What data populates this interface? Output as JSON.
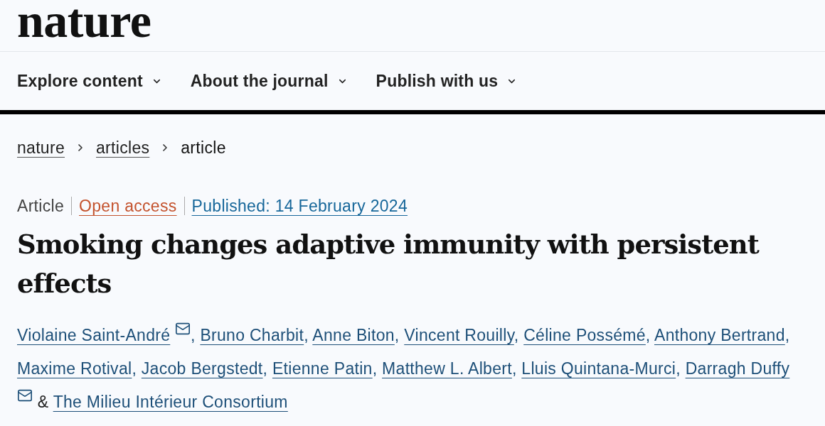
{
  "logo": "nature",
  "nav": [
    {
      "label": "Explore content"
    },
    {
      "label": "About the journal"
    },
    {
      "label": "Publish with us"
    }
  ],
  "breadcrumb": [
    {
      "label": "nature",
      "kind": "link"
    },
    {
      "label": "articles",
      "kind": "link"
    },
    {
      "label": "article",
      "kind": "current"
    }
  ],
  "article": {
    "meta": [
      {
        "label": "Article",
        "kind": "type"
      },
      {
        "label": "Open access",
        "kind": "access"
      },
      {
        "label": "Published: 14 February 2024",
        "kind": "date"
      }
    ],
    "title": "Smoking changes adaptive immunity with persistent effects",
    "authors": [
      {
        "name": "Violaine Saint-André",
        "email": true,
        "separator": {
          "kind": "comma",
          "text": ","
        }
      },
      {
        "name": "Bruno Charbit",
        "email": false,
        "separator": {
          "kind": "comma",
          "text": ","
        }
      },
      {
        "name": "Anne Biton",
        "email": false,
        "separator": {
          "kind": "comma",
          "text": ","
        }
      },
      {
        "name": "Vincent Rouilly",
        "email": false,
        "separator": {
          "kind": "comma",
          "text": ","
        }
      },
      {
        "name": "Céline Possémé",
        "email": false,
        "separator": {
          "kind": "comma",
          "text": ","
        }
      },
      {
        "name": "Anthony Bertrand",
        "email": false,
        "separator": {
          "kind": "comma",
          "text": ","
        }
      },
      {
        "name": "Maxime Rotival",
        "email": false,
        "separator": {
          "kind": "comma",
          "text": ","
        }
      },
      {
        "name": "Jacob Bergstedt",
        "email": false,
        "separator": {
          "kind": "comma",
          "text": ","
        }
      },
      {
        "name": "Etienne Patin",
        "email": false,
        "separator": {
          "kind": "comma",
          "text": ","
        }
      },
      {
        "name": "Matthew L. Albert",
        "email": false,
        "separator": {
          "kind": "comma",
          "text": ","
        }
      },
      {
        "name": "Lluis Quintana-Murci",
        "email": false,
        "separator": {
          "kind": "comma",
          "text": ","
        }
      },
      {
        "name": "Darragh Duffy",
        "email": true,
        "separator": {
          "kind": "conjunction",
          "text": "&"
        }
      },
      {
        "name": "The Milieu Intérieur Consortium",
        "email": false
      }
    ]
  }
}
